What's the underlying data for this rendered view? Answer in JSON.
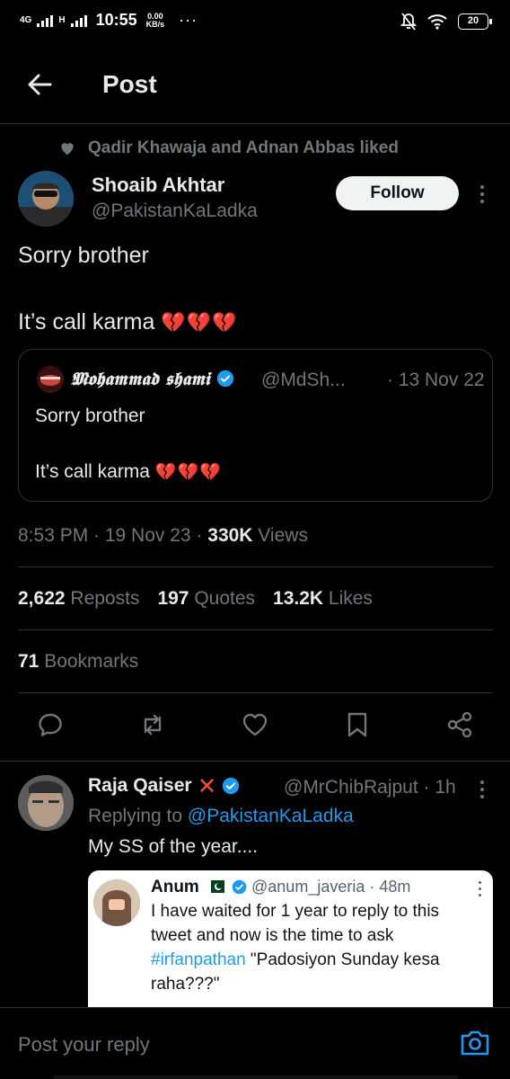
{
  "status_bar": {
    "network": "4G",
    "network2": "H",
    "time": "10:55",
    "speed_value": "0.00",
    "speed_unit": "KB/s",
    "dots": "···",
    "battery": "20"
  },
  "header": {
    "title": "Post"
  },
  "social_context": "Qadir Khawaja and Adnan Abbas liked",
  "author": {
    "name": "Shoaib Akhtar",
    "handle": "@PakistanKaLadka",
    "follow_label": "Follow"
  },
  "tweet": {
    "line1": "Sorry brother",
    "line2": "It’s call karma",
    "emojis": "💔💔💔"
  },
  "quote": {
    "name": "𝕸𝖔𝖍𝖆𝖒𝖒𝖆𝖉 𝖘𝖍𝖆𝖒𝖎",
    "handle": "@MdSh...",
    "date": "· 13 Nov 22",
    "line1": "Sorry brother",
    "line2": "It’s call karma",
    "emojis": "💔💔💔"
  },
  "meta": {
    "time_date": "8:53 PM · 19 Nov 23 · ",
    "views_count": "330K",
    "views_label": " Views"
  },
  "stats": {
    "reposts_count": "2,622",
    "reposts_label": " Reposts",
    "quotes_count": "197",
    "quotes_label": " Quotes",
    "likes_count": "13.2K",
    "likes_label": " Likes",
    "bookmarks_count": "71",
    "bookmarks_label": " Bookmarks"
  },
  "reply": {
    "name": "Raja Qaiser",
    "handle": "@MrChibRajput · 1h",
    "replying_prefix": "Replying to ",
    "replying_to": "@PakistanKaLadka",
    "text": "My SS of the year....",
    "embedded": {
      "name": "Anum",
      "handle": "@anum_javeria · 48m",
      "text_before": "I have waited for 1 year to reply to this tweet and now is the time to ask ",
      "hashtag": "#irfanpathan",
      "text_after": " \"Padosiyon Sunday kesa raha???\""
    }
  },
  "compose": {
    "placeholder": "Post your reply"
  },
  "colors": {
    "background": "#000000",
    "accent": "#1d9bf0",
    "muted": "#71767b",
    "text": "#e7e9ea"
  }
}
